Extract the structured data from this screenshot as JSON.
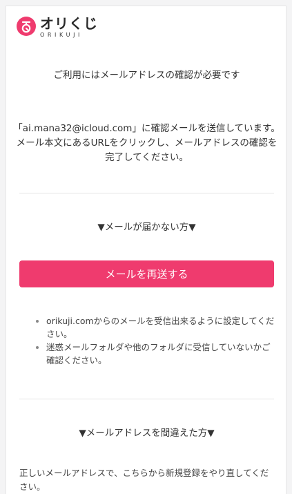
{
  "brand": {
    "name": "オリくじ",
    "sub": "ORIKUJI",
    "accent": "#ef3b6e",
    "mark_icon": "orikuji-logo-icon"
  },
  "confirm": {
    "title": "ご利用にはメールアドレスの確認が必要です",
    "message_lines": [
      "「ai.mana32@icloud.com」に確認メールを送信しています。",
      "メール本文にあるURLをクリックし、メールアドレスの確認を",
      "完了してください。"
    ]
  },
  "not_received": {
    "heading": "▼メールが届かない方▼",
    "resend_button": "メールを再送する",
    "tips": [
      "orikuji.comからのメールを受信出来るように設定してください。",
      "迷惑メールフォルダや他のフォルダに受信していないかご確認ください。"
    ]
  },
  "wrong_address": {
    "heading": "▼メールアドレスを間違えた方▼",
    "text": "正しいメールアドレスで、こちらから新規登録をやり直してください。"
  }
}
